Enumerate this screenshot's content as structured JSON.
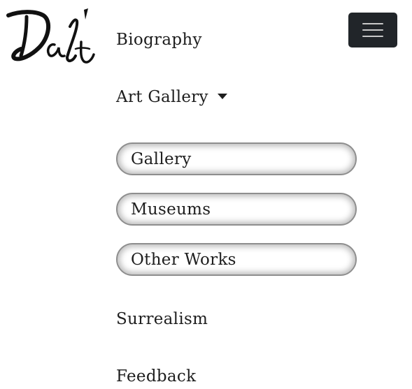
{
  "brand": {
    "logo_icon": "dali-signature-logo"
  },
  "toggler": {
    "icon": "hamburger-menu-icon",
    "color": "#212529"
  },
  "nav": {
    "biography": "Biography",
    "art_gallery": "Art Gallery",
    "surrealism": "Surrealism",
    "feedback": "Feedback"
  },
  "dropdown": {
    "items": [
      {
        "label": "Gallery"
      },
      {
        "label": "Museums"
      },
      {
        "label": "Other Works"
      }
    ]
  }
}
